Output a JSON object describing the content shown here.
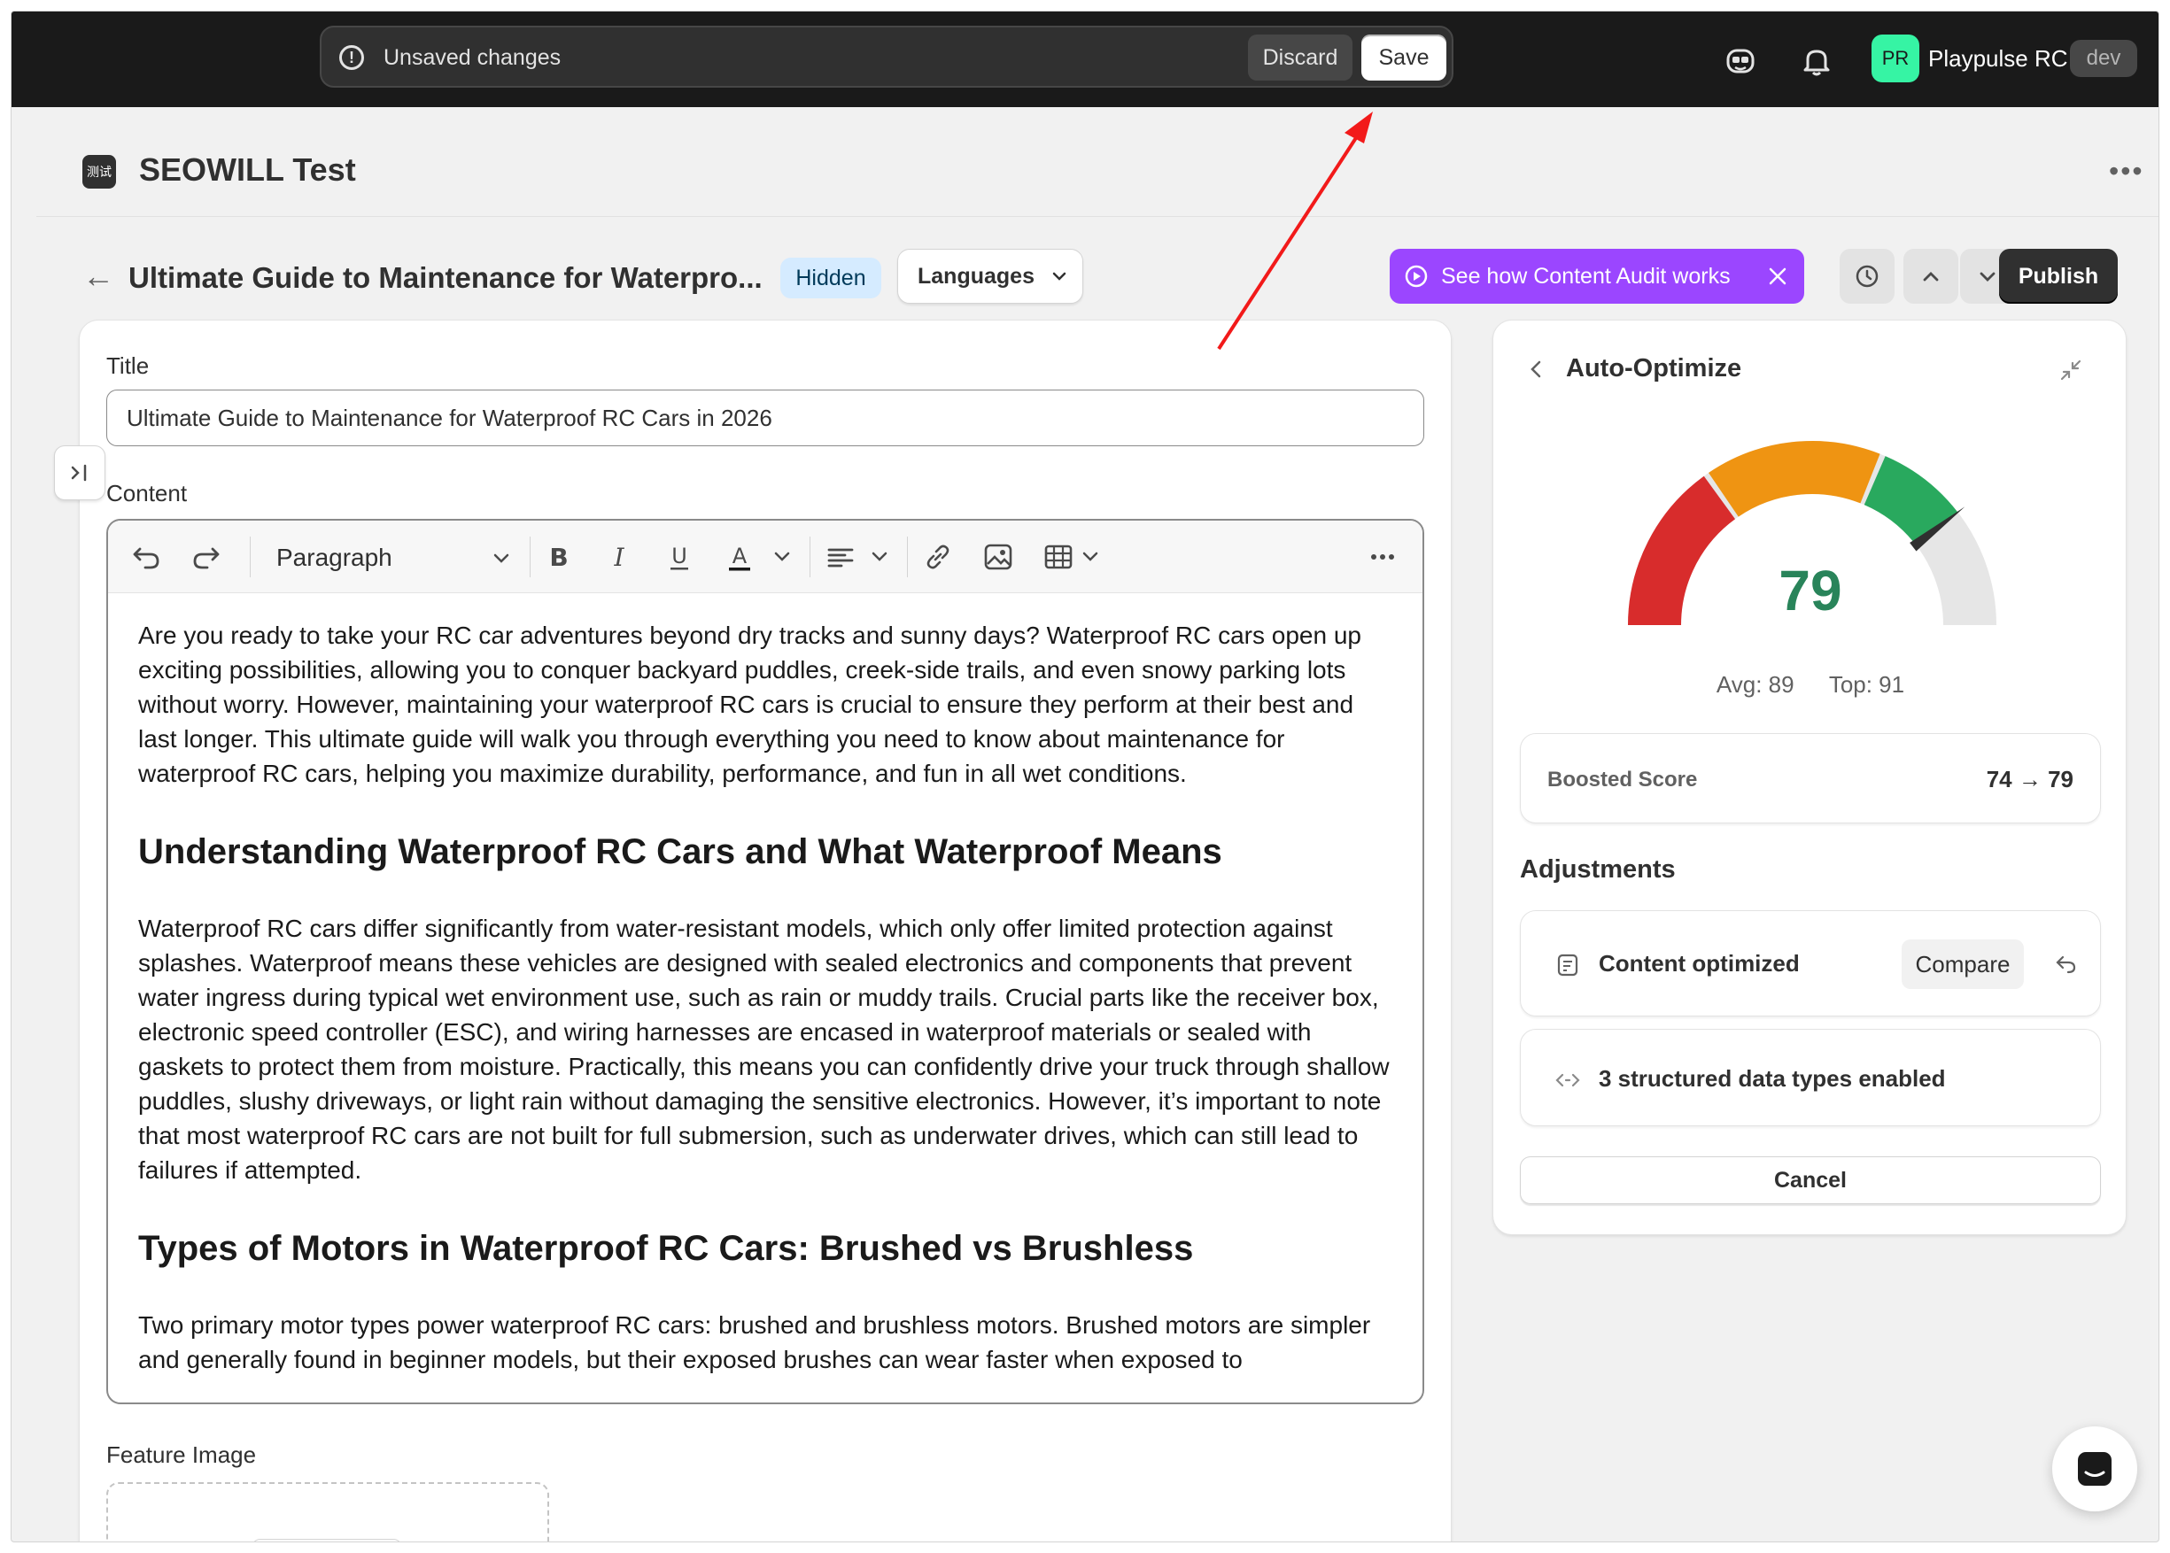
{
  "topbar": {
    "unsaved_text": "Unsaved changes",
    "discard_label": "Discard",
    "save_label": "Save",
    "avatar_initials": "PR",
    "store_name": "Playpulse RC",
    "env_badge": "dev"
  },
  "app": {
    "logo_text": "测试",
    "name": "SEOWILL Test"
  },
  "page": {
    "title": "Ultimate Guide to Maintenance for Waterpro...",
    "status_badge": "Hidden",
    "languages_label": "Languages",
    "audit_label": "See how Content Audit works",
    "publish_label": "Publish"
  },
  "form": {
    "title_label": "Title",
    "title_value": "Ultimate Guide to Maintenance for Waterproof RC Cars in 2026",
    "content_label": "Content",
    "paragraph_style": "Paragraph",
    "feature_image_label": "Feature Image"
  },
  "content": {
    "p1": "Are you ready to take your RC car adventures beyond dry tracks and sunny days? Waterproof RC cars open up exciting possibilities, allowing you to conquer backyard puddles, creek-side trails, and even snowy parking lots without worry. However, maintaining your waterproof RC cars is crucial to ensure they perform at their best and last longer. This ultimate guide will walk you through everything you need to know about maintenance for waterproof RC cars, helping you maximize durability, performance, and fun in all wet conditions.",
    "h1": "Understanding Waterproof RC Cars and What Waterproof Means",
    "p2": "Waterproof RC cars differ significantly from water-resistant models, which only offer limited protection against splashes. Waterproof means these vehicles are designed with sealed electronics and components that prevent water ingress during typical wet environment use, such as rain or muddy trails. Crucial parts like the receiver box, electronic speed controller (ESC), and wiring harnesses are encased in waterproof materials or sealed with gaskets to protect them from moisture. Practically, this means you can confidently drive your truck through shallow puddles, slushy driveways, or light rain without damaging the sensitive electronics. However, it’s important to note that most waterproof RC cars are not built for full submersion, such as underwater drives, which can still lead to failures if attempted.",
    "h2": "Types of Motors in Waterproof RC Cars: Brushed vs Brushless",
    "p3": "Two primary motor types power waterproof RC cars: brushed and brushless motors. Brushed motors are simpler and generally found in beginner models, but their exposed brushes can wear faster when exposed to"
  },
  "panel": {
    "title": "Auto-Optimize",
    "score": 79,
    "score_text": "79",
    "avg_text": "Avg: 89",
    "top_text": "Top: 91",
    "boosted_label": "Boosted Score",
    "boosted_value": "74 → 79",
    "adjustments_heading": "Adjustments",
    "adjustment1_label": "Content optimized",
    "compare_label": "Compare",
    "adjustment2_label": "3 structured data types enabled",
    "cancel_label": "Cancel"
  },
  "colors": {
    "gauge_red": "#d82c2c",
    "gauge_orange": "#ef9412",
    "gauge_green": "#29a95e",
    "gauge_track": "#e6e6e6",
    "score_green": "#29845a",
    "audit_purple": "#9b46ff",
    "annotation_red": "#f21a1a"
  },
  "icons": {
    "unsaved": "alert-circle-icon",
    "nav": "ai-assistant-icon",
    "bell": "bell-icon",
    "back": "arrow-left-icon",
    "chevron": "chevron-down-icon",
    "play": "play-circle-icon",
    "close": "close-icon",
    "history": "clock-icon",
    "chat": "chat-icon"
  }
}
